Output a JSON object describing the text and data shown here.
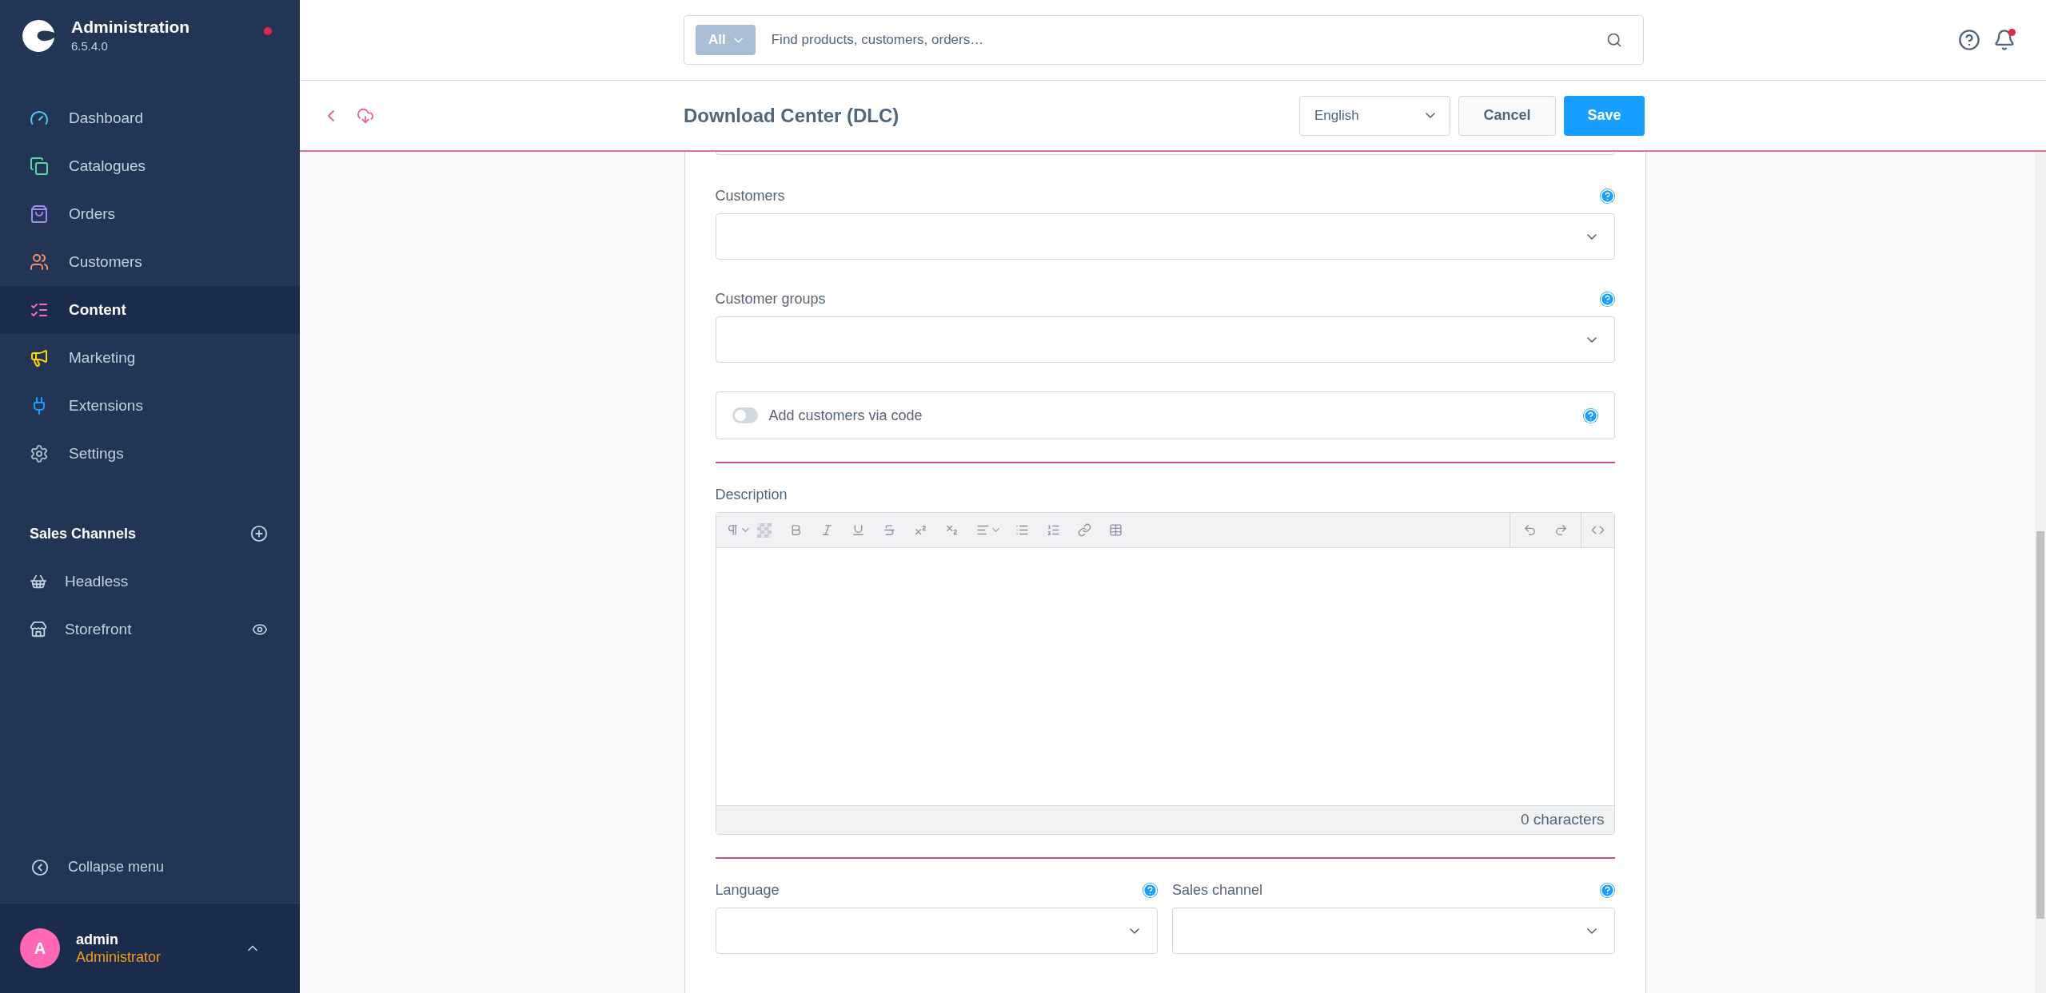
{
  "sidebar": {
    "title": "Administration",
    "version": "6.5.4.0",
    "items": [
      {
        "label": "Dashboard",
        "selected": false
      },
      {
        "label": "Catalogues",
        "selected": false
      },
      {
        "label": "Orders",
        "selected": false
      },
      {
        "label": "Customers",
        "selected": false
      },
      {
        "label": "Content",
        "selected": true
      },
      {
        "label": "Marketing",
        "selected": false
      },
      {
        "label": "Extensions",
        "selected": false
      },
      {
        "label": "Settings",
        "selected": false
      }
    ],
    "sales_channels": {
      "title": "Sales Channels",
      "items": [
        {
          "label": "Headless"
        },
        {
          "label": "Storefront"
        }
      ]
    },
    "collapse": "Collapse menu",
    "user": {
      "initial": "A",
      "name": "admin",
      "role": "Administrator"
    }
  },
  "search": {
    "filter": "All",
    "placeholder": "Find products, customers, orders…"
  },
  "page_header": {
    "title": "Download Center (DLC)",
    "language": "English",
    "cancel": "Cancel",
    "save": "Save"
  },
  "form": {
    "customers": {
      "label": "Customers"
    },
    "customer_groups": {
      "label": "Customer groups"
    },
    "code_toggle": {
      "label": "Add customers via code",
      "on": false
    },
    "description": {
      "label": "Description",
      "counter": "0 characters"
    },
    "language": {
      "label": "Language"
    },
    "sales_channel": {
      "label": "Sales channel"
    }
  }
}
